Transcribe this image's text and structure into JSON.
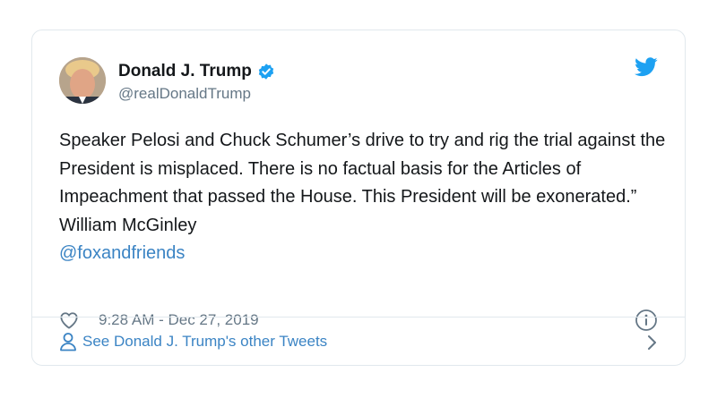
{
  "tweet": {
    "author_name": "Donald J. Trump",
    "author_handle": "@realDonaldTrump",
    "text": "Speaker Pelosi and Chuck Schumer’s drive to try and rig the trial against the President is misplaced. There is no factual basis for the Articles of Impeachment that passed the House. This President will be exonerated.” William McGinley",
    "mention": "@foxandfriends",
    "timestamp": "9:28 AM - Dec 27, 2019"
  },
  "footer": {
    "label": "See Donald J. Trump's other Tweets"
  },
  "icons": {
    "verified": "verified-badge-icon",
    "brand": "twitter-bird-icon",
    "like": "heart-icon",
    "info": "info-icon",
    "profile": "person-icon",
    "more": "chevron-right-icon"
  },
  "colors": {
    "accent": "#1da1f2",
    "link": "#3b84c4",
    "muted": "#657786",
    "border": "#e1e8ed"
  }
}
